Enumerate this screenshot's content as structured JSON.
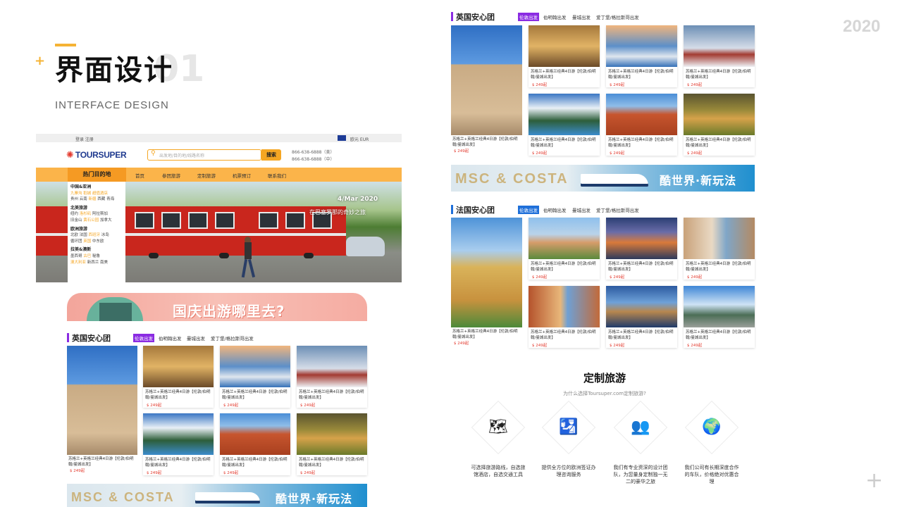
{
  "portfolio": {
    "title_zh": "界面设计",
    "title_num": "01",
    "title_en": "INTERFACE DESIGN",
    "year": "2020",
    "accent": "#f5b335"
  },
  "site": {
    "topbar": {
      "login": "登录  注册",
      "currency": "欧元  EUR"
    },
    "logo": "TOURSUPER",
    "search": {
      "placeholder": "出发地/目的地/线路名称",
      "button": "搜索"
    },
    "phones": [
      "866-638-6888（美）",
      "866-638-6888（中）"
    ],
    "nav": {
      "hot": "热门目的地",
      "items": [
        "首页",
        "参团旅游",
        "定制旅游",
        "机票预订",
        "联系我们"
      ]
    },
    "dropdown": [
      {
        "region": "中国&亚洲",
        "lines": [
          [
            "九寨沟",
            "稻城",
            "超值酒店"
          ],
          [
            "贵州",
            "云南",
            "新疆",
            "西藏",
            "青海"
          ]
        ]
      },
      {
        "region": "北美旅游",
        "lines": [
          [
            "纽约",
            "洛杉矶",
            "阿拉斯加"
          ],
          [
            "旧金山",
            "黄石公园",
            "加拿大"
          ]
        ]
      },
      {
        "region": "欧洲旅游",
        "lines": [
          [
            "北欧",
            "法国",
            "西班牙",
            "冰岛"
          ],
          [
            "循环团",
            "英国",
            "中东欧"
          ]
        ]
      },
      {
        "region": "拉美&澳新",
        "lines": [
          [
            "墨西哥",
            "古巴",
            "秘鲁"
          ],
          [
            "澳大利亚",
            "新西兰",
            "南美"
          ]
        ]
      }
    ],
    "banner": {
      "date": "4/Mar 2020",
      "subtitle": "在巴塞罗那的奇妙之旅"
    },
    "promo": "国庆出游哪里去?",
    "cruise": {
      "brand": "MSC & COSTA",
      "slogan": "酷世界·新玩法"
    }
  },
  "sections": {
    "uk": {
      "title": "英国安心团",
      "tabs": [
        "伦敦出发",
        "伯明翰出发",
        "曼城出发",
        "爱丁堡/格拉斯哥出发"
      ],
      "card_text": "苏格兰+英格兰经典4日游【伦敦/伯明翰/曼城出发】",
      "price": "$ 249起"
    },
    "fr": {
      "title": "法国安心团",
      "tabs": [
        "伦敦出发",
        "伯明翰出发",
        "曼城出发",
        "爱丁堡/格拉斯哥出发"
      ],
      "card_text": "苏格兰+英格兰经典4日游【伦敦/伯明翰/曼城出发】",
      "price": "$ 249起"
    }
  },
  "custom": {
    "title": "定制旅游",
    "subtitle": "为什么选择Toursuper.com定制旅游?",
    "features": [
      {
        "icon": "map-icon",
        "text": "可选择旅游路线，自选旅馆酒店，自选交通工具"
      },
      {
        "icon": "visa-icon",
        "text": "提供全方位的欧洲签证办理咨询服务"
      },
      {
        "icon": "team-icon",
        "text": "我们有专业资深的设计团队，为您量身定制独一无二的豪华之旅"
      },
      {
        "icon": "globe-icon",
        "text": "我们公司有长期深度合作的车队，价格绝对优惠合理"
      }
    ]
  },
  "colors": {
    "orange": "#fbb44a",
    "purple": "#8a2be2",
    "blue": "#1e6fd9",
    "price_red": "#e33b2f"
  }
}
